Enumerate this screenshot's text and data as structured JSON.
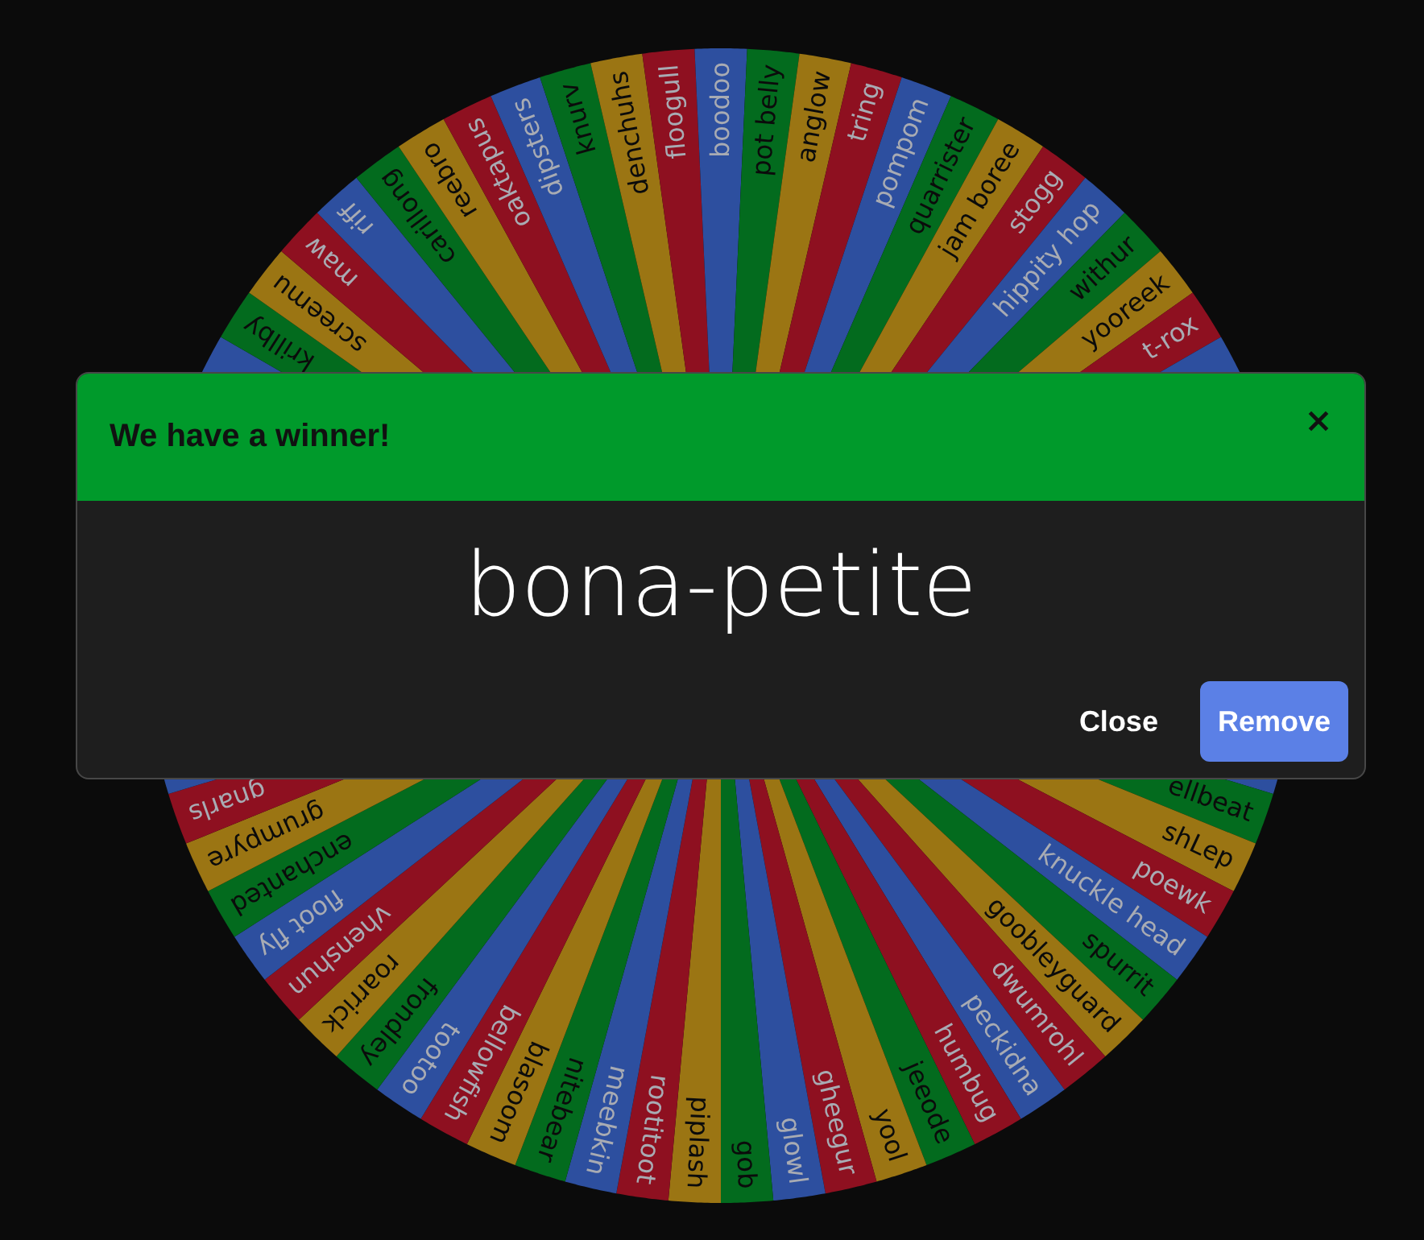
{
  "wheel": {
    "segments_top": [
      "krillby",
      "screemu",
      "maw",
      "riff",
      "carillong",
      "reebro",
      "oaktapus",
      "dipsters",
      "knurv",
      "denchuhs",
      "floogull",
      "boodoo",
      "pot belly",
      "anglow",
      "tring",
      "pompom",
      "quarrister",
      "jam boree",
      "stogg",
      "hippity hop",
      "withur",
      "yooreek",
      "t-rox"
    ],
    "segments_bottom": [
      "ellbeat",
      "shLep",
      "poewk",
      "knuckle head",
      "spurrit",
      "goobleyguard",
      "dwumrohl",
      "peckidna",
      "humbug",
      "jeeode",
      "yool",
      "gheegur",
      "glowl",
      "gob",
      "piplash",
      "rootitoot",
      "meebkin",
      "nitebear",
      "blasoom",
      "bellowfish",
      "tootoo",
      "frondley",
      "roarrick",
      "vhenshun",
      "floot fly",
      "enchanted",
      "grumpyre",
      "gnarls"
    ]
  },
  "dialog": {
    "title": "We have a winner!",
    "winner": "bona-petite",
    "buttons": [
      {
        "label": "Close",
        "kind": "text"
      },
      {
        "label": "Remove",
        "kind": "primary"
      }
    ]
  }
}
